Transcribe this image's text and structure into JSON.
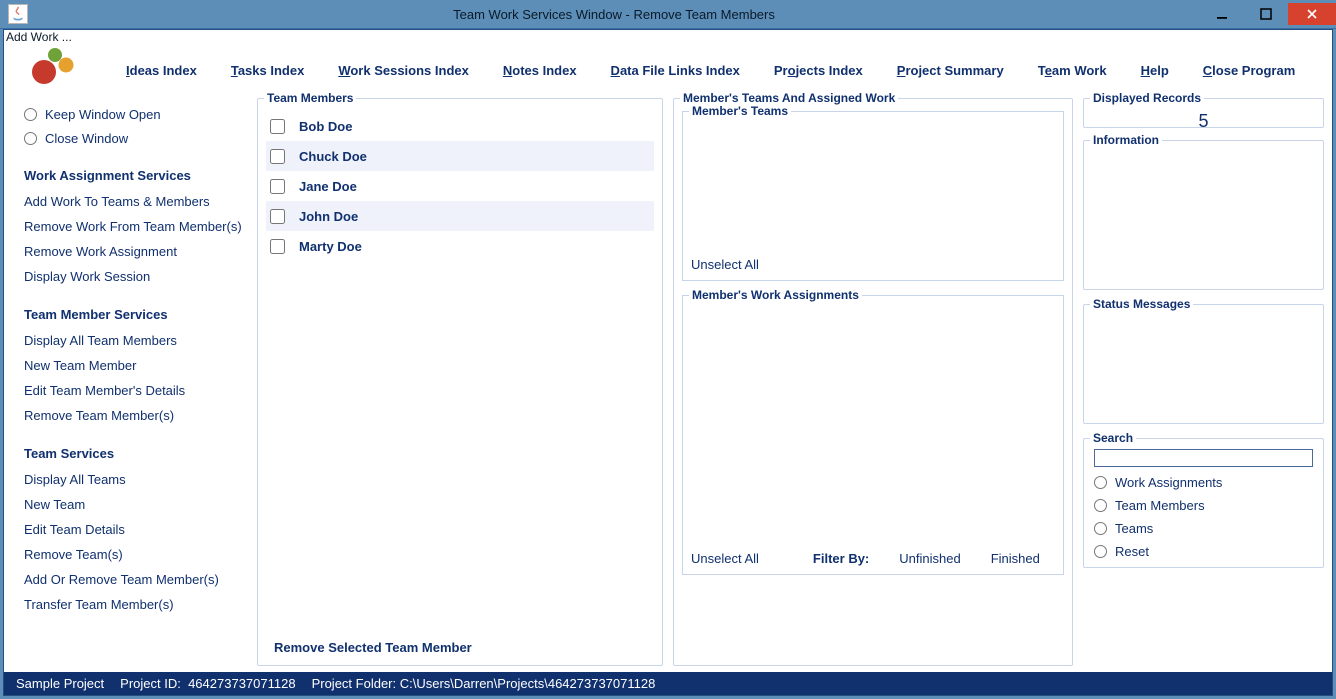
{
  "titlebar": {
    "title": "Team Work Services Window - Remove Team Members"
  },
  "top_strip": "Add Work ...",
  "menus": {
    "ideas": "Ideas Index",
    "tasks": "Tasks Index",
    "work_sessions": "Work Sessions Index",
    "notes": "Notes Index",
    "data_file": "Data File Links Index",
    "projects": "Projects Index",
    "project_summary": "Project Summary",
    "team_work": "Team Work",
    "help": "Help",
    "close": "Close Program"
  },
  "sidebar": {
    "keep_open": "Keep Window Open",
    "close_window": "Close Window",
    "heading_was": "Work Assignment Services",
    "was_items": [
      "Add Work To Teams & Members",
      "Remove Work From Team Member(s)",
      "Remove Work Assignment",
      "Display Work Session"
    ],
    "heading_tms": "Team Member Services",
    "tms_items": [
      "Display All Team Members",
      "New Team Member",
      "Edit Team Member's Details",
      "Remove Team Member(s)"
    ],
    "heading_ts": "Team Services",
    "ts_items": [
      "Display All Teams",
      "New Team",
      "Edit Team Details",
      "Remove Team(s)",
      "Add Or Remove Team Member(s)",
      "Transfer Team Member(s)"
    ]
  },
  "members": {
    "legend": "Team Members",
    "items": [
      "Bob Doe",
      "Chuck Doe",
      "Jane Doe",
      "John Doe",
      "Marty Doe"
    ],
    "footer": "Remove Selected Team Member"
  },
  "mid": {
    "legend": "Member's Teams And Assigned Work",
    "teams_legend": "Member's Teams",
    "work_legend": "Member's Work Assignments",
    "unselect": "Unselect All",
    "filter_by": "Filter By:",
    "unfinished": "Unfinished",
    "finished": "Finished"
  },
  "right": {
    "disp_legend": "Displayed Records",
    "disp_value": "5",
    "info_legend": "Information",
    "status_legend": "Status Messages",
    "search_legend": "Search",
    "search_value": "",
    "opt_wa": "Work Assignments",
    "opt_tm": "Team Members",
    "opt_teams": "Teams",
    "opt_reset": "Reset"
  },
  "statusbar": {
    "project_name": "Sample Project",
    "project_id_label": "Project ID:",
    "project_id": "464273737071128",
    "project_folder_label": "Project Folder:",
    "project_folder": "C:\\Users\\Darren\\Projects\\464273737071128"
  }
}
